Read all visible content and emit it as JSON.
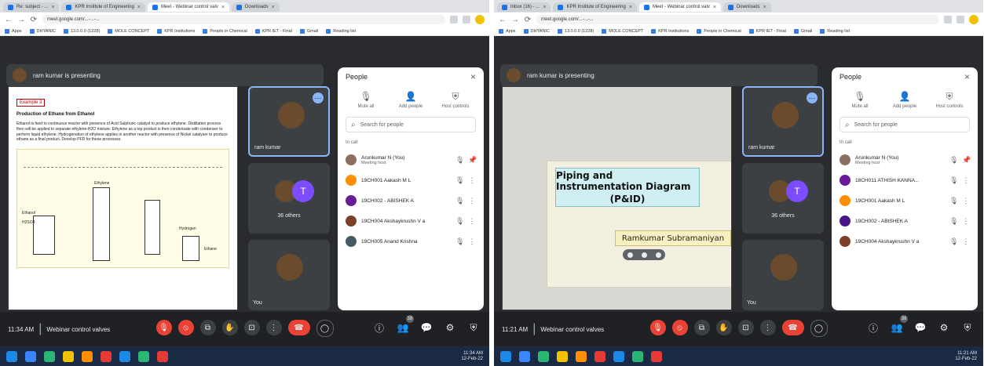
{
  "panels": [
    {
      "browser": {
        "tabs": [
          {
            "label": "Re: subject - ..."
          },
          {
            "label": "KPR Institute of Engineering"
          },
          {
            "label": "Meet - Webinar control valv",
            "active": true
          },
          {
            "label": "Downloads"
          }
        ],
        "url": "meet.google.com/...-...-...",
        "bookmarks": [
          "Apps",
          "DHYANIC",
          "13.0.0.0 (1228)",
          "MOLE CONCEPT",
          "KPR Institutions",
          "People in Chemical",
          "KPR IET - Final",
          "Gmail",
          "Reading list"
        ]
      },
      "presenting_text": "ram kumar is presenting",
      "shared_content": {
        "example_label": "Example 3",
        "title": "Production of Ethane from Ethanol",
        "body": "Ethanol is feed to continuous reactor with presence of Acid Sulphuric catalyst to produce ethylene. Distillation process then will be applied to separate ethylene-H2O mixture. Ethylene as a top product is then condensate with condenser to perform liquid ethylene. Hydrogenation of ethylene applies in another reactor with presence of Nickel catalyser to produce ethane as a final product. Develop PFD for these processes.",
        "diagram_labels": {
          "ethanol": "Ethanol",
          "h2so4": "H2SO4",
          "ethylene": "Ethylene",
          "hydrogen": "Hydrogen",
          "ethane": "Ethane"
        }
      },
      "tiles": [
        {
          "name": "ram kumar",
          "selected": true
        },
        {
          "others": "36 others",
          "avatar_letter": "T"
        },
        {
          "name": "You"
        }
      ],
      "people_panel": {
        "title": "People",
        "actions": {
          "mute_all": "Mute all",
          "add_people": "Add people",
          "host_controls": "Host controls"
        },
        "search_placeholder": "Search for people",
        "section": "In call",
        "participants": [
          {
            "name": "Arunkumar N (You)",
            "sub": "Meeting host"
          },
          {
            "name": "19CH001 Aakash M L"
          },
          {
            "name": "19CH002 - ABISHEK A"
          },
          {
            "name": "19CH004 Akshaykrushn V a"
          },
          {
            "name": "19CH005 Anand Krishna"
          }
        ]
      },
      "bottom_bar": {
        "time": "11:34 AM",
        "meeting": "Webinar control valves",
        "people_count": "38"
      },
      "taskbar_time": {
        "time": "11:34 AM",
        "date": "12-Feb-22"
      }
    },
    {
      "browser": {
        "tabs": [
          {
            "label": "Inbox (16) - ..."
          },
          {
            "label": "KPR Institute of Engineering"
          },
          {
            "label": "Meet - Webinar control valv",
            "active": true
          },
          {
            "label": "Downloads"
          }
        ],
        "url": "meet.google.com/...-...-...",
        "bookmarks": [
          "Apps",
          "DHYANIC",
          "13.0.0.0 (1228)",
          "MOLE CONCEPT",
          "KPR Institutions",
          "People in Chemical",
          "KPR IET - Final",
          "Gmail",
          "Reading list"
        ]
      },
      "presenting_text": "ram kumar is presenting",
      "shared_content": {
        "title_line1": "Piping and Instrumentation Diagram",
        "title_line2": "(P&ID)",
        "presenter_name": "Ramkumar Subramaniyan"
      },
      "tiles": [
        {
          "name": "ram kumar",
          "selected": true
        },
        {
          "others": "36 others",
          "avatar_letter": "T"
        },
        {
          "name": "You"
        }
      ],
      "people_panel": {
        "title": "People",
        "actions": {
          "mute_all": "Mute all",
          "add_people": "Add people",
          "host_controls": "Host controls"
        },
        "search_placeholder": "Search for people",
        "section": "In call",
        "participants": [
          {
            "name": "Arunkumar N (You)",
            "sub": "Meeting host"
          },
          {
            "name": "18CH011 ATHISH KANNA..."
          },
          {
            "name": "19CH001 Aakash M L"
          },
          {
            "name": "19CH002 - ABISHEK A"
          },
          {
            "name": "19CH004 Akshaykrushn V a"
          }
        ]
      },
      "bottom_bar": {
        "time": "11:21 AM",
        "meeting": "Webinar control valves",
        "people_count": "38"
      },
      "taskbar_time": {
        "time": "11:21 AM",
        "date": "12-Feb-22"
      }
    }
  ]
}
